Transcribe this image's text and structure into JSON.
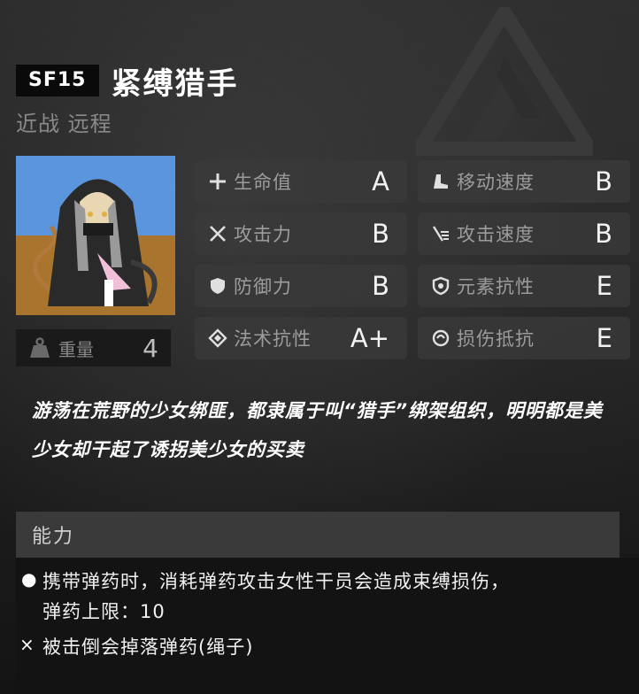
{
  "enemy": {
    "code": "SF15",
    "name": "紧缚猎手",
    "types": "近战 远程",
    "description": "游荡在荒野的少女绑匪，都隶属于叫“猎手”绑架组织，明明都是美少女却干起了诱拐美少女的买卖",
    "weight_label": "重量",
    "weight_value": "4"
  },
  "stats": [
    {
      "label": "生命值",
      "grade": "A",
      "icon": "plus-icon"
    },
    {
      "label": "移动速度",
      "grade": "B",
      "icon": "boot-icon"
    },
    {
      "label": "攻击力",
      "grade": "B",
      "icon": "crossed-swords-icon"
    },
    {
      "label": "攻击速度",
      "grade": "B",
      "icon": "swift-slash-icon"
    },
    {
      "label": "防御力",
      "grade": "B",
      "icon": "shield-icon"
    },
    {
      "label": "元素抗性",
      "grade": "E",
      "icon": "element-shield-icon"
    },
    {
      "label": "法术抗性",
      "grade": "A+",
      "icon": "diamond-icon"
    },
    {
      "label": "损伤抵抗",
      "grade": "E",
      "icon": "swirl-icon"
    }
  ],
  "ability": {
    "header": "能力",
    "items": [
      {
        "bullet": "●",
        "text_line1": "携带弹药时，消耗弹药攻击女性干员会造成束缚损伤，",
        "text_line2": "弹药上限：10"
      },
      {
        "bullet": "×",
        "text_line1": "被击倒会掉落弹药(绳子)"
      }
    ]
  },
  "colors": {
    "background": "#151515",
    "stat_box": "#3a3a3a",
    "ability_header": "#3a3a3a",
    "text": "#ffffff",
    "muted": "#8a8a8a"
  }
}
